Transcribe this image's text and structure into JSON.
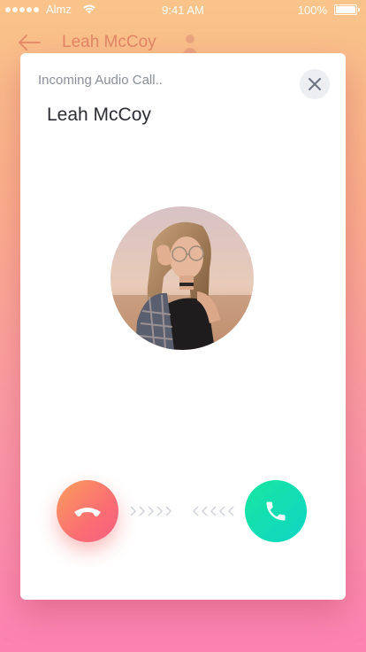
{
  "status_bar": {
    "carrier": "Almz",
    "time": "9:41 AM",
    "battery": "100%"
  },
  "background_header": {
    "title": "Leah McCoy"
  },
  "call_modal": {
    "status_text": "Incoming Audio Call..",
    "caller_name": "Leah McCoy",
    "icons": {
      "close": "close-icon",
      "decline": "phone-hangup-icon",
      "accept": "phone-icon",
      "swipe_right": "chevron-right-icon",
      "swipe_left": "chevron-left-icon"
    }
  },
  "colors": {
    "decline_gradient_start": "#fb9e5e",
    "decline_gradient_end": "#f75f84",
    "accept_gradient_start": "#18e6a0",
    "accept_gradient_end": "#0fd6c5",
    "background_top": "#f9c48a",
    "background_bottom": "#fc82b2"
  }
}
